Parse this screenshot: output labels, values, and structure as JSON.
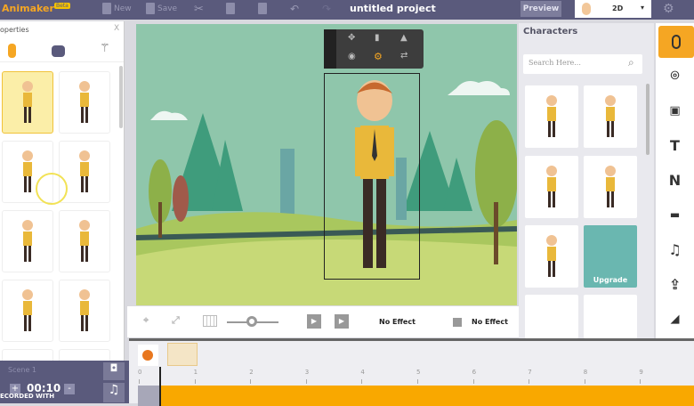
{
  "topbar": {
    "logo": "Animaker",
    "badge": "Beta",
    "new_label": "New",
    "save_label": "Save",
    "project_title": "untitled project",
    "preview_label": "Preview",
    "mode_value": "2D"
  },
  "left_panel": {
    "title": "operties",
    "close": "X",
    "tabs": [
      "character-icon",
      "object-icon",
      "magic-wand-icon"
    ]
  },
  "canvas_controls": {
    "enter_effect": "No Effect",
    "exit_effect": "No Effect"
  },
  "characters": {
    "title": "Characters",
    "search_placeholder": "Search Here...",
    "upgrade_label": "Upgrade"
  },
  "right_bar": {
    "items": [
      "character-icon",
      "location-pin-icon",
      "image-icon",
      "text-icon",
      "number-icon",
      "video-icon",
      "music-icon",
      "upload-icon",
      "background-icon"
    ],
    "text_label": "T",
    "number_label": "N"
  },
  "timeline": {
    "scene_label": "Scene 1",
    "duration": "00:10",
    "plus": "+",
    "minus": "-",
    "ruler": [
      "0",
      "1",
      "2",
      "3",
      "4",
      "5",
      "6",
      "7",
      "8",
      "9"
    ],
    "watermark": "ECORDED WITH"
  },
  "colors": {
    "accent": "#f5a623",
    "topbar": "#5a5a7c",
    "timeline_bar": "#f9a800"
  }
}
